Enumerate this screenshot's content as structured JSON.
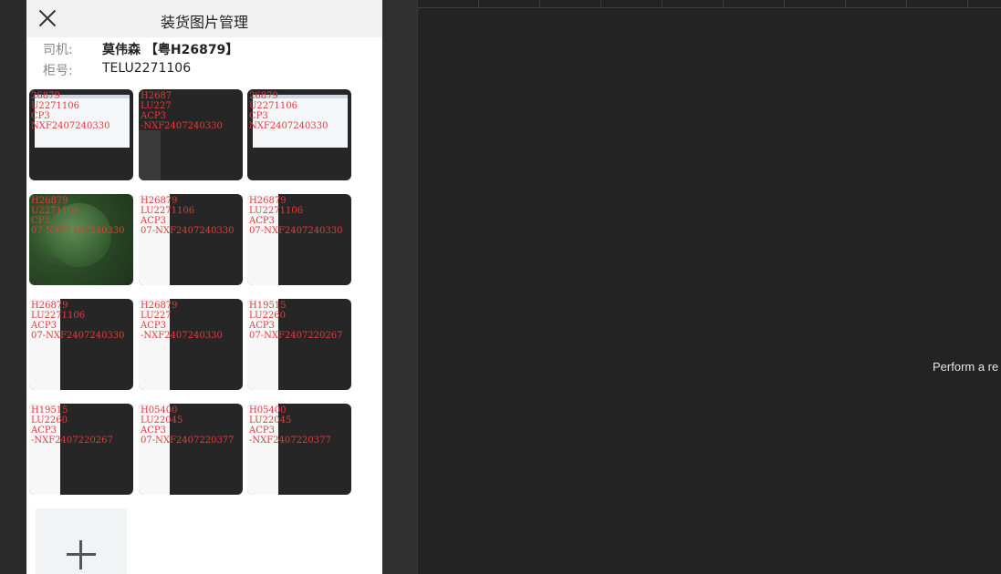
{
  "dialog": {
    "title": "装货图片管理",
    "driver_label": "司机:",
    "driver_value": "莫伟森 【粤H26879】",
    "container_label": "柜号:",
    "container_value": "TELU2271106"
  },
  "thumbnails": [
    {
      "text": "26879\nU2271106\nCP3\nNXF2407240330",
      "kind": "light"
    },
    {
      "text": "H2687\nLU227\nACP3\n-NXF2407240330",
      "kind": "dark"
    },
    {
      "text": "26879\nU2271106\nCP3\nNXF2407240330",
      "kind": "light"
    },
    {
      "text": "H26879\nU2271106\nCP3\n07-NXF2407240330",
      "kind": "leaf"
    },
    {
      "text": "H26879\nLU2271106\nACP3\n07-NXF2407240330",
      "kind": "mixed"
    },
    {
      "text": "H26879\nLU2271106\nACP3\n07-NXF2407240330",
      "kind": "mixed"
    },
    {
      "text": "H26879\nLU2271106\nACP3\n07-NXF2407240330",
      "kind": "mixed"
    },
    {
      "text": "H26879\nLU227\nACP3\n-NXF2407240330",
      "kind": "mixed"
    },
    {
      "text": "H19515\nLU2260\nACP3\n07-NXF2407220267",
      "kind": "mixed"
    },
    {
      "text": "H19515\nLU2260\nACP3\n-NXF2407220267",
      "kind": "mixed"
    },
    {
      "text": "H05400\nLU22045\nACP3\n07-NXF2407220377",
      "kind": "mixed"
    },
    {
      "text": "H05400\nLU22045\nACP3\n-NXF2407220377",
      "kind": "mixed"
    }
  ],
  "editor": {
    "message": "Perform a re"
  }
}
